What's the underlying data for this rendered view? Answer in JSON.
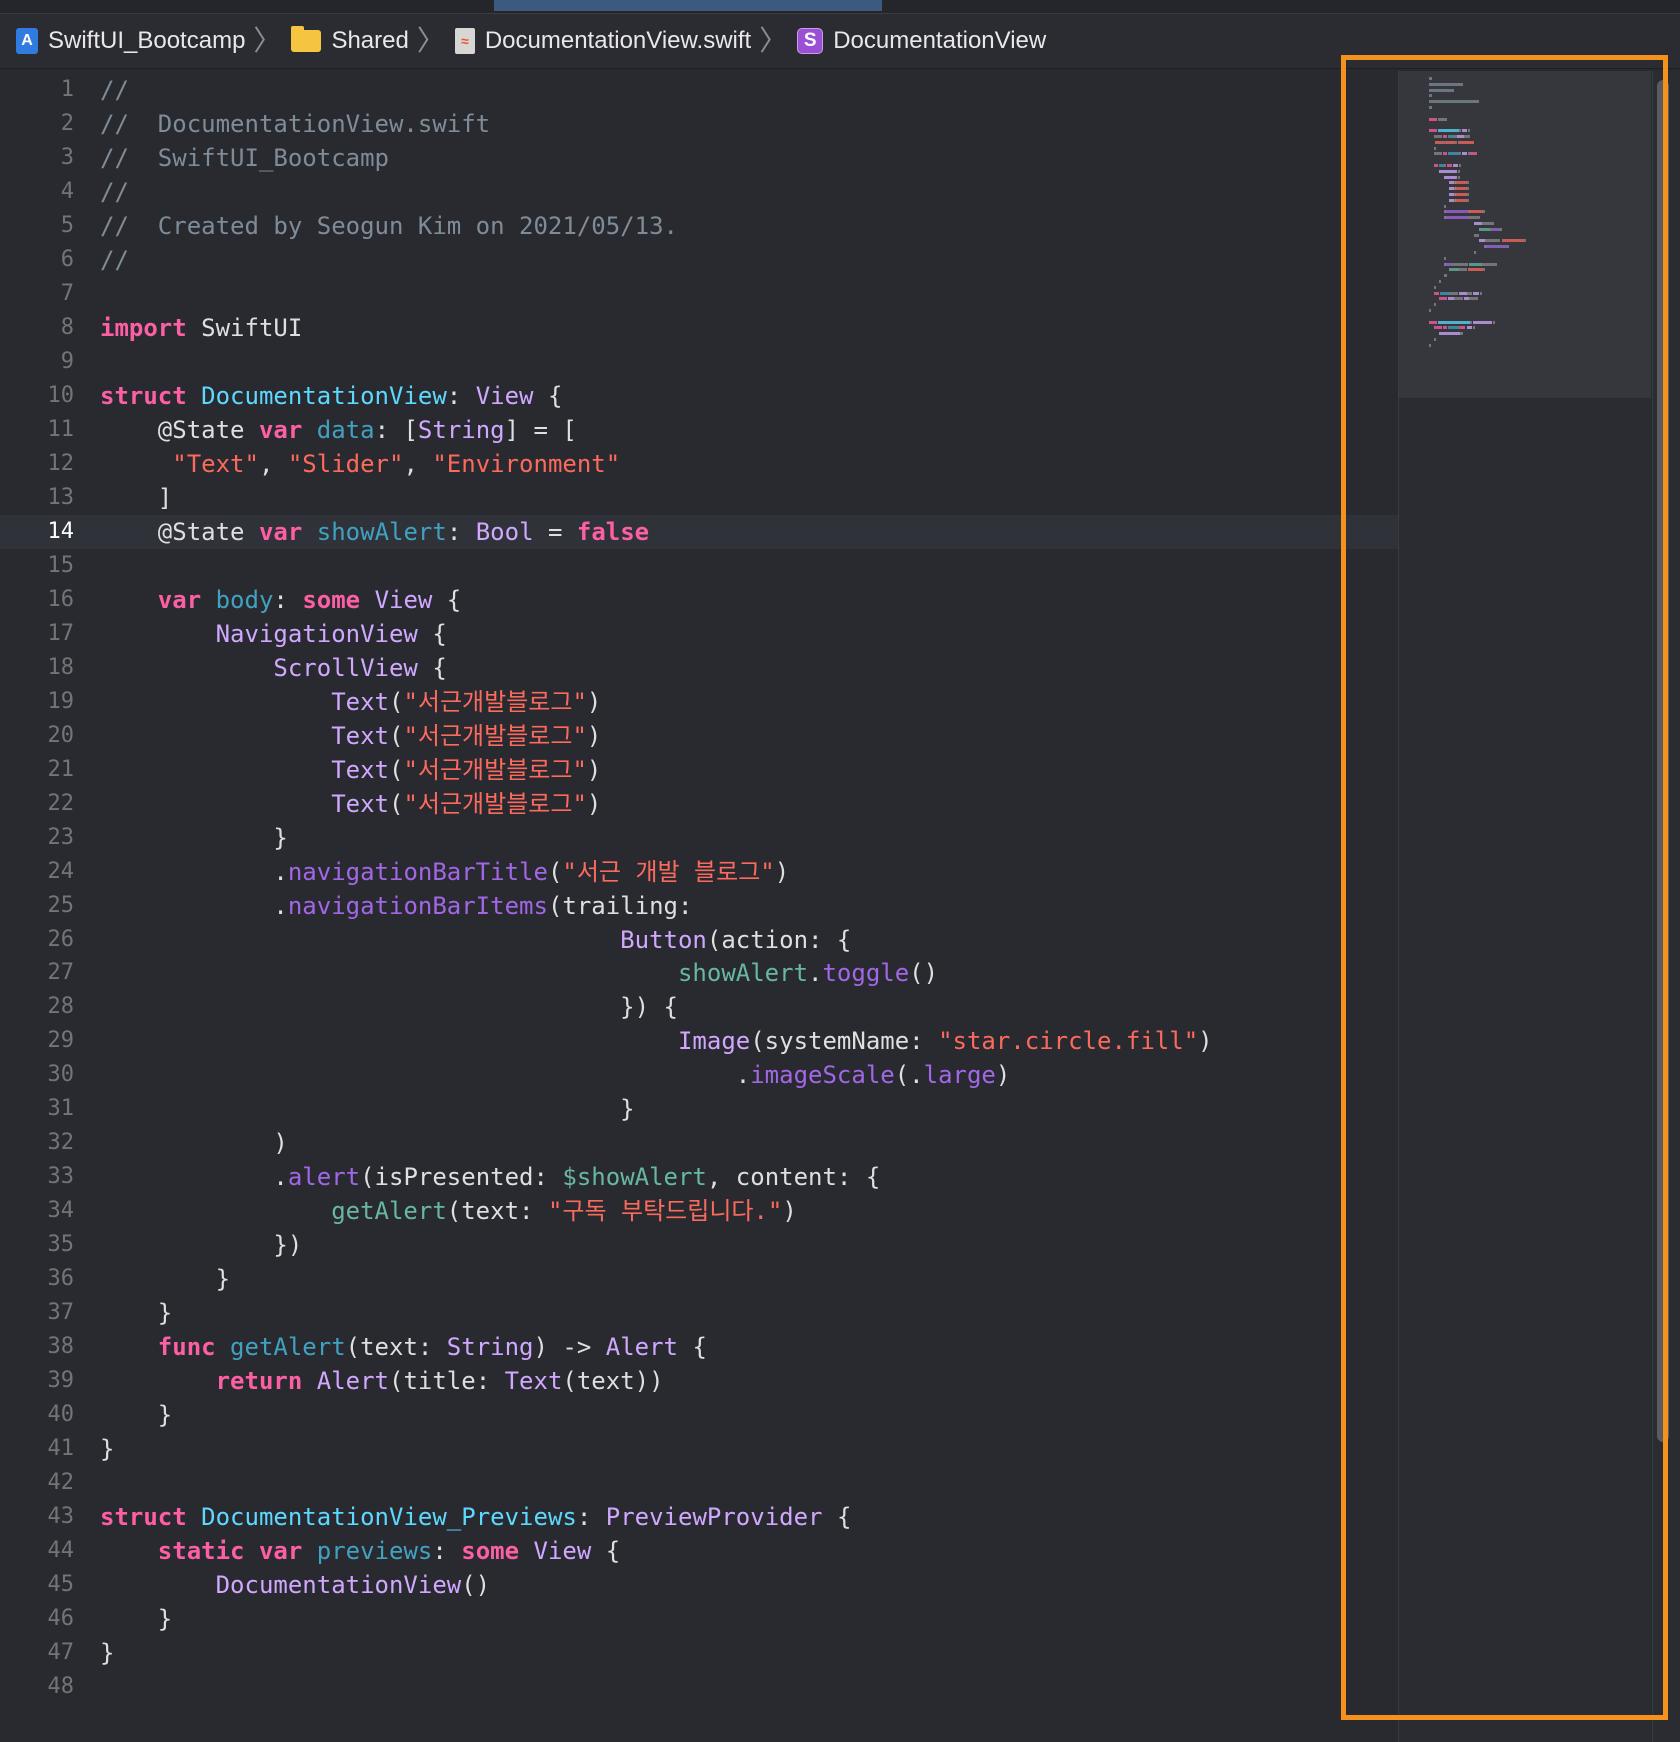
{
  "breadcrumb": {
    "items": [
      {
        "label": "SwiftUI_Bootcamp",
        "icon": "xcode-project-icon"
      },
      {
        "label": "Shared",
        "icon": "folder-icon"
      },
      {
        "label": "DocumentationView.swift",
        "icon": "swift-file-icon"
      },
      {
        "label": "DocumentationView",
        "icon": "struct-symbol-icon"
      }
    ],
    "separator": "〉"
  },
  "editor": {
    "current_line": 14,
    "colors": {
      "background": "#292a30",
      "comment": "#7f8c98",
      "keyword": "#fc5fa3",
      "type": "#d0a8ff",
      "declaration": "#5dd8ff",
      "string": "#fc6a5d",
      "method": "#a167e6",
      "local": "#67b7a4",
      "highlight_box": "#f5921e"
    },
    "lines": [
      {
        "n": "1",
        "tokens": [
          [
            "comment",
            "//"
          ]
        ]
      },
      {
        "n": "2",
        "tokens": [
          [
            "comment",
            "//  DocumentationView.swift"
          ]
        ]
      },
      {
        "n": "3",
        "tokens": [
          [
            "comment",
            "//  SwiftUI_Bootcamp"
          ]
        ]
      },
      {
        "n": "4",
        "tokens": [
          [
            "comment",
            "//"
          ]
        ]
      },
      {
        "n": "5",
        "tokens": [
          [
            "comment",
            "//  Created by Seogun Kim on 2021/05/13."
          ]
        ]
      },
      {
        "n": "6",
        "tokens": [
          [
            "comment",
            "//"
          ]
        ]
      },
      {
        "n": "7",
        "tokens": []
      },
      {
        "n": "8",
        "tokens": [
          [
            "keyword",
            "import"
          ],
          [
            "plain",
            " SwiftUI"
          ]
        ]
      },
      {
        "n": "9",
        "tokens": []
      },
      {
        "n": "10",
        "tokens": [
          [
            "keyword",
            "struct"
          ],
          [
            "plain",
            " "
          ],
          [
            "decl",
            "DocumentationView"
          ],
          [
            "plain",
            ": "
          ],
          [
            "type",
            "View"
          ],
          [
            "plain",
            " {"
          ]
        ]
      },
      {
        "n": "11",
        "tokens": [
          [
            "plain",
            "    @State "
          ],
          [
            "keyword",
            "var"
          ],
          [
            "plain",
            " "
          ],
          [
            "ident",
            "data"
          ],
          [
            "plain",
            ": ["
          ],
          [
            "type",
            "String"
          ],
          [
            "plain",
            "] = ["
          ]
        ]
      },
      {
        "n": "12",
        "tokens": [
          [
            "plain",
            "     "
          ],
          [
            "string",
            "\"Text\""
          ],
          [
            "plain",
            ", "
          ],
          [
            "string",
            "\"Slider\""
          ],
          [
            "plain",
            ", "
          ],
          [
            "string",
            "\"Environment\""
          ]
        ]
      },
      {
        "n": "13",
        "tokens": [
          [
            "plain",
            "    ]"
          ]
        ]
      },
      {
        "n": "14",
        "tokens": [
          [
            "plain",
            "    @State "
          ],
          [
            "keyword",
            "var"
          ],
          [
            "plain",
            " "
          ],
          [
            "ident",
            "showAlert"
          ],
          [
            "plain",
            ": "
          ],
          [
            "type",
            "Bool"
          ],
          [
            "plain",
            " = "
          ],
          [
            "keyword",
            "false"
          ]
        ]
      },
      {
        "n": "15",
        "tokens": []
      },
      {
        "n": "16",
        "tokens": [
          [
            "plain",
            "    "
          ],
          [
            "keyword",
            "var"
          ],
          [
            "plain",
            " "
          ],
          [
            "ident",
            "body"
          ],
          [
            "plain",
            ": "
          ],
          [
            "keyword",
            "some"
          ],
          [
            "plain",
            " "
          ],
          [
            "type",
            "View"
          ],
          [
            "plain",
            " {"
          ]
        ]
      },
      {
        "n": "17",
        "tokens": [
          [
            "plain",
            "        "
          ],
          [
            "type",
            "NavigationView"
          ],
          [
            "plain",
            " {"
          ]
        ]
      },
      {
        "n": "18",
        "tokens": [
          [
            "plain",
            "            "
          ],
          [
            "type",
            "ScrollView"
          ],
          [
            "plain",
            " {"
          ]
        ]
      },
      {
        "n": "19",
        "tokens": [
          [
            "plain",
            "                "
          ],
          [
            "type",
            "Text"
          ],
          [
            "plain",
            "("
          ],
          [
            "string",
            "\"서근개발블로그\""
          ],
          [
            "plain",
            ")"
          ]
        ]
      },
      {
        "n": "20",
        "tokens": [
          [
            "plain",
            "                "
          ],
          [
            "type",
            "Text"
          ],
          [
            "plain",
            "("
          ],
          [
            "string",
            "\"서근개발블로그\""
          ],
          [
            "plain",
            ")"
          ]
        ]
      },
      {
        "n": "21",
        "tokens": [
          [
            "plain",
            "                "
          ],
          [
            "type",
            "Text"
          ],
          [
            "plain",
            "("
          ],
          [
            "string",
            "\"서근개발블로그\""
          ],
          [
            "plain",
            ")"
          ]
        ]
      },
      {
        "n": "22",
        "tokens": [
          [
            "plain",
            "                "
          ],
          [
            "type",
            "Text"
          ],
          [
            "plain",
            "("
          ],
          [
            "string",
            "\"서근개발블로그\""
          ],
          [
            "plain",
            ")"
          ]
        ]
      },
      {
        "n": "23",
        "tokens": [
          [
            "plain",
            "            }"
          ]
        ]
      },
      {
        "n": "24",
        "tokens": [
          [
            "plain",
            "            ."
          ],
          [
            "method",
            "navigationBarTitle"
          ],
          [
            "plain",
            "("
          ],
          [
            "string",
            "\"서근 개발 블로그\""
          ],
          [
            "plain",
            ")"
          ]
        ]
      },
      {
        "n": "25",
        "tokens": [
          [
            "plain",
            "            ."
          ],
          [
            "method",
            "navigationBarItems"
          ],
          [
            "plain",
            "(trailing:"
          ]
        ]
      },
      {
        "n": "26",
        "tokens": [
          [
            "plain",
            "                                    "
          ],
          [
            "type",
            "Button"
          ],
          [
            "plain",
            "(action: {"
          ]
        ]
      },
      {
        "n": "27",
        "tokens": [
          [
            "plain",
            "                                        "
          ],
          [
            "local",
            "showAlert"
          ],
          [
            "plain",
            "."
          ],
          [
            "method",
            "toggle"
          ],
          [
            "plain",
            "()"
          ]
        ]
      },
      {
        "n": "28",
        "tokens": [
          [
            "plain",
            "                                    }) {"
          ]
        ]
      },
      {
        "n": "29",
        "tokens": [
          [
            "plain",
            "                                        "
          ],
          [
            "type",
            "Image"
          ],
          [
            "plain",
            "(systemName: "
          ],
          [
            "string",
            "\"star.circle.fill\""
          ],
          [
            "plain",
            ")"
          ]
        ]
      },
      {
        "n": "30",
        "tokens": [
          [
            "plain",
            "                                            ."
          ],
          [
            "method",
            "imageScale"
          ],
          [
            "plain",
            "(."
          ],
          [
            "method",
            "large"
          ],
          [
            "plain",
            ")"
          ]
        ]
      },
      {
        "n": "31",
        "tokens": [
          [
            "plain",
            "                                    }"
          ]
        ]
      },
      {
        "n": "32",
        "tokens": [
          [
            "plain",
            "            )"
          ]
        ]
      },
      {
        "n": "33",
        "tokens": [
          [
            "plain",
            "            ."
          ],
          [
            "method",
            "alert"
          ],
          [
            "plain",
            "(isPresented: "
          ],
          [
            "local",
            "$showAlert"
          ],
          [
            "plain",
            ", content: {"
          ]
        ]
      },
      {
        "n": "34",
        "tokens": [
          [
            "plain",
            "                "
          ],
          [
            "local",
            "getAlert"
          ],
          [
            "plain",
            "(text: "
          ],
          [
            "string",
            "\"구독 부탁드립니다.\""
          ],
          [
            "plain",
            ")"
          ]
        ]
      },
      {
        "n": "35",
        "tokens": [
          [
            "plain",
            "            })"
          ]
        ]
      },
      {
        "n": "36",
        "tokens": [
          [
            "plain",
            "        }"
          ]
        ]
      },
      {
        "n": "37",
        "tokens": [
          [
            "plain",
            "    }"
          ]
        ]
      },
      {
        "n": "38",
        "tokens": [
          [
            "plain",
            "    "
          ],
          [
            "keyword",
            "func"
          ],
          [
            "plain",
            " "
          ],
          [
            "ident",
            "getAlert"
          ],
          [
            "plain",
            "(text: "
          ],
          [
            "type",
            "String"
          ],
          [
            "plain",
            ") -> "
          ],
          [
            "type",
            "Alert"
          ],
          [
            "plain",
            " {"
          ]
        ]
      },
      {
        "n": "39",
        "tokens": [
          [
            "plain",
            "        "
          ],
          [
            "keyword",
            "return"
          ],
          [
            "plain",
            " "
          ],
          [
            "type",
            "Alert"
          ],
          [
            "plain",
            "(title: "
          ],
          [
            "type",
            "Text"
          ],
          [
            "plain",
            "(text))"
          ]
        ]
      },
      {
        "n": "40",
        "tokens": [
          [
            "plain",
            "    }"
          ]
        ]
      },
      {
        "n": "41",
        "tokens": [
          [
            "plain",
            "}"
          ]
        ]
      },
      {
        "n": "42",
        "tokens": []
      },
      {
        "n": "43",
        "tokens": [
          [
            "keyword",
            "struct"
          ],
          [
            "plain",
            " "
          ],
          [
            "decl",
            "DocumentationView_Previews"
          ],
          [
            "plain",
            ": "
          ],
          [
            "type",
            "PreviewProvider"
          ],
          [
            "plain",
            " {"
          ]
        ]
      },
      {
        "n": "44",
        "tokens": [
          [
            "plain",
            "    "
          ],
          [
            "keyword",
            "static"
          ],
          [
            "plain",
            " "
          ],
          [
            "keyword",
            "var"
          ],
          [
            "plain",
            " "
          ],
          [
            "ident",
            "previews"
          ],
          [
            "plain",
            ": "
          ],
          [
            "keyword",
            "some"
          ],
          [
            "plain",
            " "
          ],
          [
            "type",
            "View"
          ],
          [
            "plain",
            " {"
          ]
        ]
      },
      {
        "n": "45",
        "tokens": [
          [
            "plain",
            "        "
          ],
          [
            "type",
            "DocumentationView"
          ],
          [
            "plain",
            "()"
          ]
        ]
      },
      {
        "n": "46",
        "tokens": [
          [
            "plain",
            "    }"
          ]
        ]
      },
      {
        "n": "47",
        "tokens": [
          [
            "plain",
            "}"
          ]
        ]
      },
      {
        "n": "48",
        "tokens": []
      }
    ]
  }
}
